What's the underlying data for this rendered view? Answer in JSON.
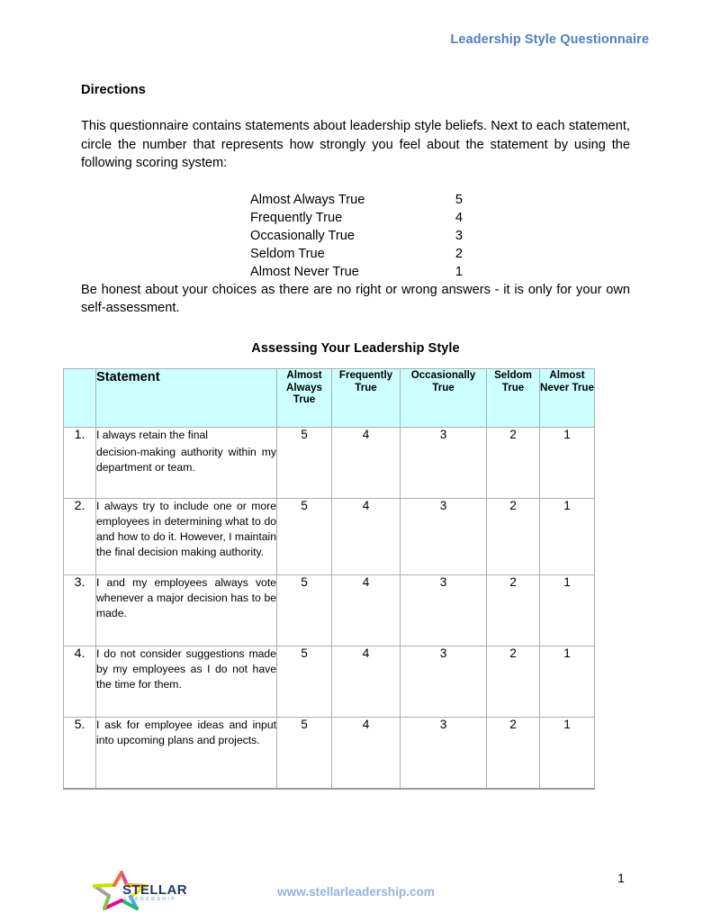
{
  "document": {
    "running_head": "Leadership Style Questionnaire",
    "accent_color": "#4F81BD",
    "table_header_bg": "#CCFFFF",
    "url_color": "#93B3DE"
  },
  "directions": {
    "heading": "Directions",
    "intro": "This questionnaire contains statements about leadership style beliefs. Next to each statement, circle the number that represents how strongly you feel about the statement by using the following scoring system:",
    "scoring": [
      {
        "label": "Almost Always True",
        "value": "5"
      },
      {
        "label": "Frequently True",
        "value": "4"
      },
      {
        "label": "Occasionally True",
        "value": "3"
      },
      {
        "label": "Seldom True",
        "value": "2"
      },
      {
        "label": "Almost Never True",
        "value": "1"
      }
    ],
    "honesty_note": "Be honest about your choices as there are no right or wrong answers - it is only for your own self-assessment."
  },
  "assessment": {
    "title": "Assessing Your Leadership Style",
    "columns": {
      "number": "",
      "statement": "Statement",
      "almost_always_true": "Almost Always True",
      "frequently_true": "Frequently True",
      "occasionally_true": "Occasionally True",
      "seldom_true": "Seldom True",
      "almost_never_true": "Almost Never True"
    },
    "rows": [
      {
        "number": "1.",
        "statement_line1": "I always retain the final",
        "statement_rest": "decision-making authority within my department or team.",
        "scores": [
          "5",
          "4",
          "3",
          "2",
          "1"
        ]
      },
      {
        "number": "2.",
        "statement_line1": "",
        "statement_rest": "I always try to include one or more employees in determining what to do and how to do it. However, I maintain the final decision making authority.",
        "scores": [
          "5",
          "4",
          "3",
          "2",
          "1"
        ]
      },
      {
        "number": "3.",
        "statement_line1": "",
        "statement_rest": "I and my employees always vote whenever a major decision has to be made.",
        "scores": [
          "5",
          "4",
          "3",
          "2",
          "1"
        ]
      },
      {
        "number": "4.",
        "statement_line1": "",
        "statement_rest": "I do not consider suggestions made by my employees as I do not have the time for them.",
        "scores": [
          "5",
          "4",
          "3",
          "2",
          "1"
        ]
      },
      {
        "number": "5.",
        "statement_line1": "",
        "statement_rest": "I ask for employee ideas and input into upcoming plans and projects.",
        "scores": [
          "5",
          "4",
          "3",
          "2",
          "1"
        ]
      }
    ]
  },
  "footer": {
    "logo_text": "STELLAR",
    "logo_subtext": "LEADERSHIP",
    "url": "www.stellarleadership.com",
    "page_number": "1"
  }
}
